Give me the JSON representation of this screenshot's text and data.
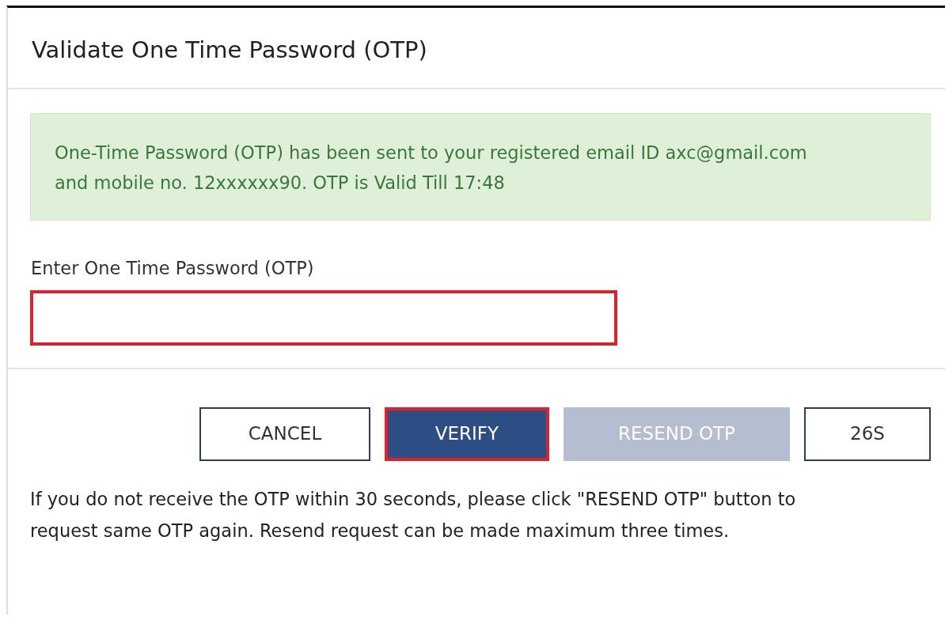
{
  "dialog": {
    "title": "Validate One Time Password (OTP)"
  },
  "alert": {
    "text": "One-Time Password (OTP) has been sent to your registered email ID axc@gmail.com and mobile no. 12xxxxxx90. OTP is Valid Till 17:48"
  },
  "otp_field": {
    "label": "Enter One Time Password (OTP)",
    "highlighted": true
  },
  "buttons": [
    {
      "label": "CANCEL",
      "kind": "outline",
      "disabled": false,
      "highlighted": false
    },
    {
      "label": "VERIFY",
      "kind": "primary",
      "disabled": false,
      "highlighted": true
    },
    {
      "label": "RESEND OTP",
      "kind": "primary",
      "disabled": true,
      "highlighted": false
    },
    {
      "label": "26S",
      "kind": "outline",
      "disabled": false,
      "highlighted": false
    }
  ],
  "note": "If you do not receive the OTP within 30 seconds, please click \"RESEND OTP\" button to request same OTP again. Resend request can be made maximum three times."
}
